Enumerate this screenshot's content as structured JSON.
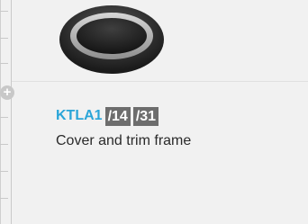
{
  "product": {
    "code": "KTLA1",
    "options": [
      "/14",
      "/31"
    ],
    "description": "Cover and trim frame",
    "image_icon": "round-cover-icon"
  },
  "controls": {
    "expand_icon": "plus-icon",
    "expand_symbol": "+"
  },
  "colors": {
    "code": "#2aa5d8",
    "chip": "#6d6d6d",
    "background": "#f1f1f1"
  }
}
